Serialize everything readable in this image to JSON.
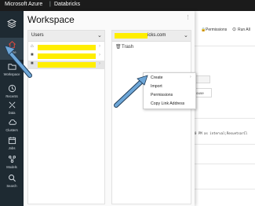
{
  "topbar": {
    "brand": "Microsoft Azure",
    "separator": "|",
    "product": "Databricks"
  },
  "sidebar": {
    "items": [
      {
        "label": "Home",
        "icon": "home-icon",
        "active": true
      },
      {
        "label": "Workspace",
        "icon": "folder-icon"
      },
      {
        "label": "Recents",
        "icon": "clock-icon"
      },
      {
        "label": "Data",
        "icon": "data-icon"
      },
      {
        "label": "Clusters",
        "icon": "cloud-icon"
      },
      {
        "label": "Jobs",
        "icon": "calendar-icon"
      },
      {
        "label": "Models",
        "icon": "models-icon"
      },
      {
        "label": "Search",
        "icon": "search-icon"
      }
    ],
    "active_color": "#e04a3f"
  },
  "workspace": {
    "title": "Workspace",
    "menu_dots": "⋮",
    "users_column": {
      "header": "Users",
      "rows": [
        {
          "icon": "home-icon",
          "text": "",
          "redacted": true
        },
        {
          "icon": "folder-icon",
          "text": "",
          "redacted": true
        },
        {
          "icon": "folder-icon",
          "text": "",
          "redacted": true
        }
      ]
    },
    "user_column": {
      "header_suffix": "icks.com",
      "rows": [
        {
          "icon": "trash-icon",
          "text": "Trash"
        }
      ]
    }
  },
  "background": {
    "permissions": "Permissions",
    "run_all": "Run All",
    "cell_fragment": "ouse",
    "code_fragment": "0 PM as interval;ResuetsarCl"
  },
  "context_menu": {
    "items": [
      "Create",
      "Import",
      "Permissions",
      "Copy Link Address"
    ],
    "caret": "›"
  },
  "colors": {
    "highlight": "#ffee00",
    "arrow": "#6ea7d8"
  }
}
